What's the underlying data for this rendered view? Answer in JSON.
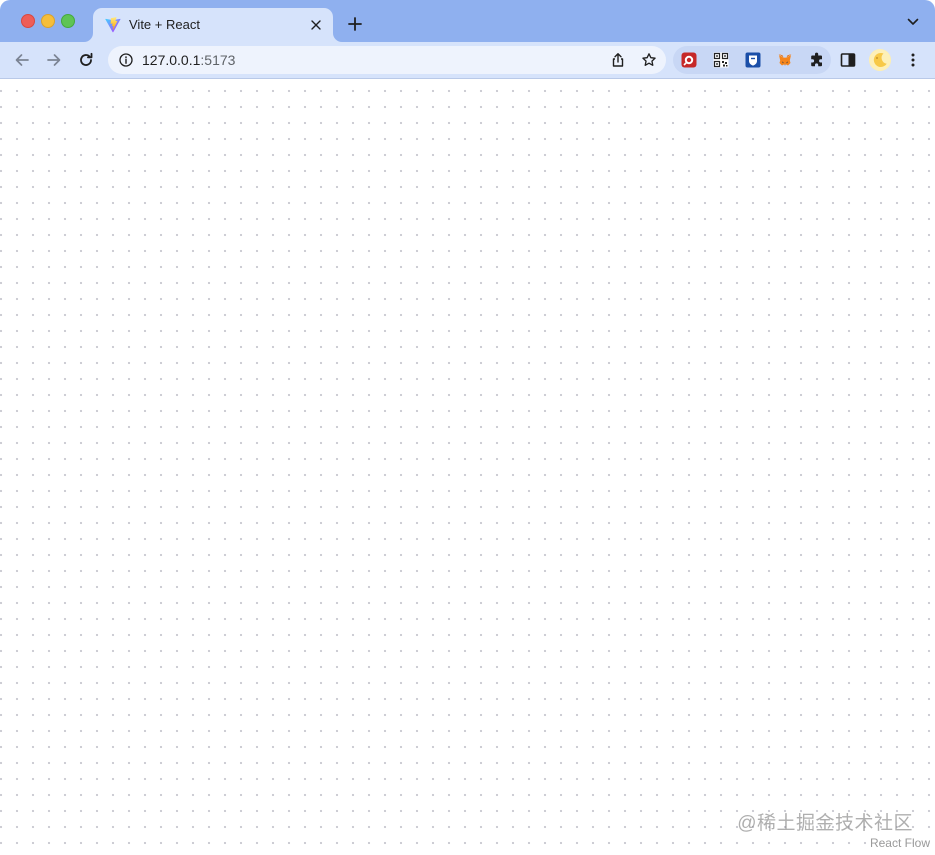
{
  "browser": {
    "tab": {
      "title": "Vite + React",
      "favicon": "vite-logo-icon"
    },
    "new_tab_icon": "plus-icon",
    "tab_menu_icon": "chevron-down-icon",
    "nav": {
      "back_icon": "arrow-left-icon",
      "forward_icon": "arrow-right-icon",
      "reload_icon": "reload-icon"
    },
    "omnibox": {
      "host": "127.0.0.1",
      "port": ":5173",
      "info_icon": "info-icon",
      "share_icon": "share-icon",
      "bookmark_icon": "star-icon"
    },
    "extensions": [
      "red-extension-icon",
      "qr-code-icon",
      "shield-extension-icon",
      "metamask-fox-icon",
      "puzzle-icon"
    ],
    "side_panel_icon": "side-panel-icon",
    "menu_icon": "kebab-menu-icon",
    "colors": {
      "tabstrip": "#8fb0ef",
      "toolbar": "#d6e3fb",
      "omnibox": "#eef3fd"
    }
  },
  "page": {
    "watermark": "@稀土掘金技术社区",
    "attribution": "React Flow"
  }
}
